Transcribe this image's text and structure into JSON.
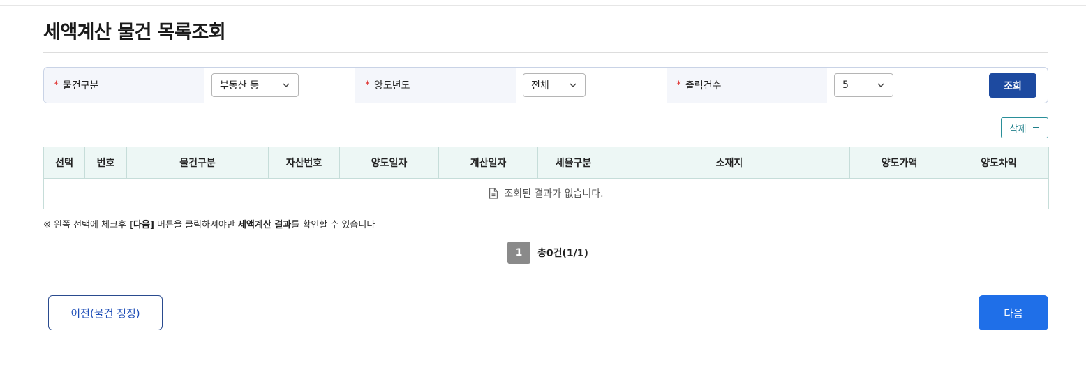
{
  "page": {
    "title": "세액계산 물건 목록조회"
  },
  "search": {
    "fields": [
      {
        "label": "물건구분",
        "value": "부동산 등"
      },
      {
        "label": "양도년도",
        "value": "전체"
      },
      {
        "label": "출력건수",
        "value": "5"
      }
    ],
    "required_mark": "*",
    "submit_label": "조회"
  },
  "toolbar": {
    "delete_label": "삭제"
  },
  "table": {
    "columns": [
      "선택",
      "번호",
      "물건구분",
      "자산번호",
      "양도일자",
      "계산일자",
      "세율구분",
      "소재지",
      "양도가액",
      "양도차익"
    ],
    "empty_message": "조회된 결과가 없습니다."
  },
  "notice": {
    "prefix": "※ 왼쪽 선택에 체크후 ",
    "bold1": "[다음]",
    "middle": " 버튼을 클릭하셔야만 ",
    "bold2": "세액계산 결과",
    "suffix": "를 확인할 수 있습니다"
  },
  "pagination": {
    "current": "1",
    "total_text": "총0건(1/1)"
  },
  "footer": {
    "prev_label": "이전(물건 정정)",
    "next_label": "다음"
  },
  "icons": {
    "chevron": "chevron-down-icon",
    "empty": "document-icon",
    "minus": "minus-icon"
  },
  "colors": {
    "primary": "#1d4aa0",
    "next": "#1f6fe8",
    "required": "#e0312f",
    "teal": "#1f7f8a"
  }
}
